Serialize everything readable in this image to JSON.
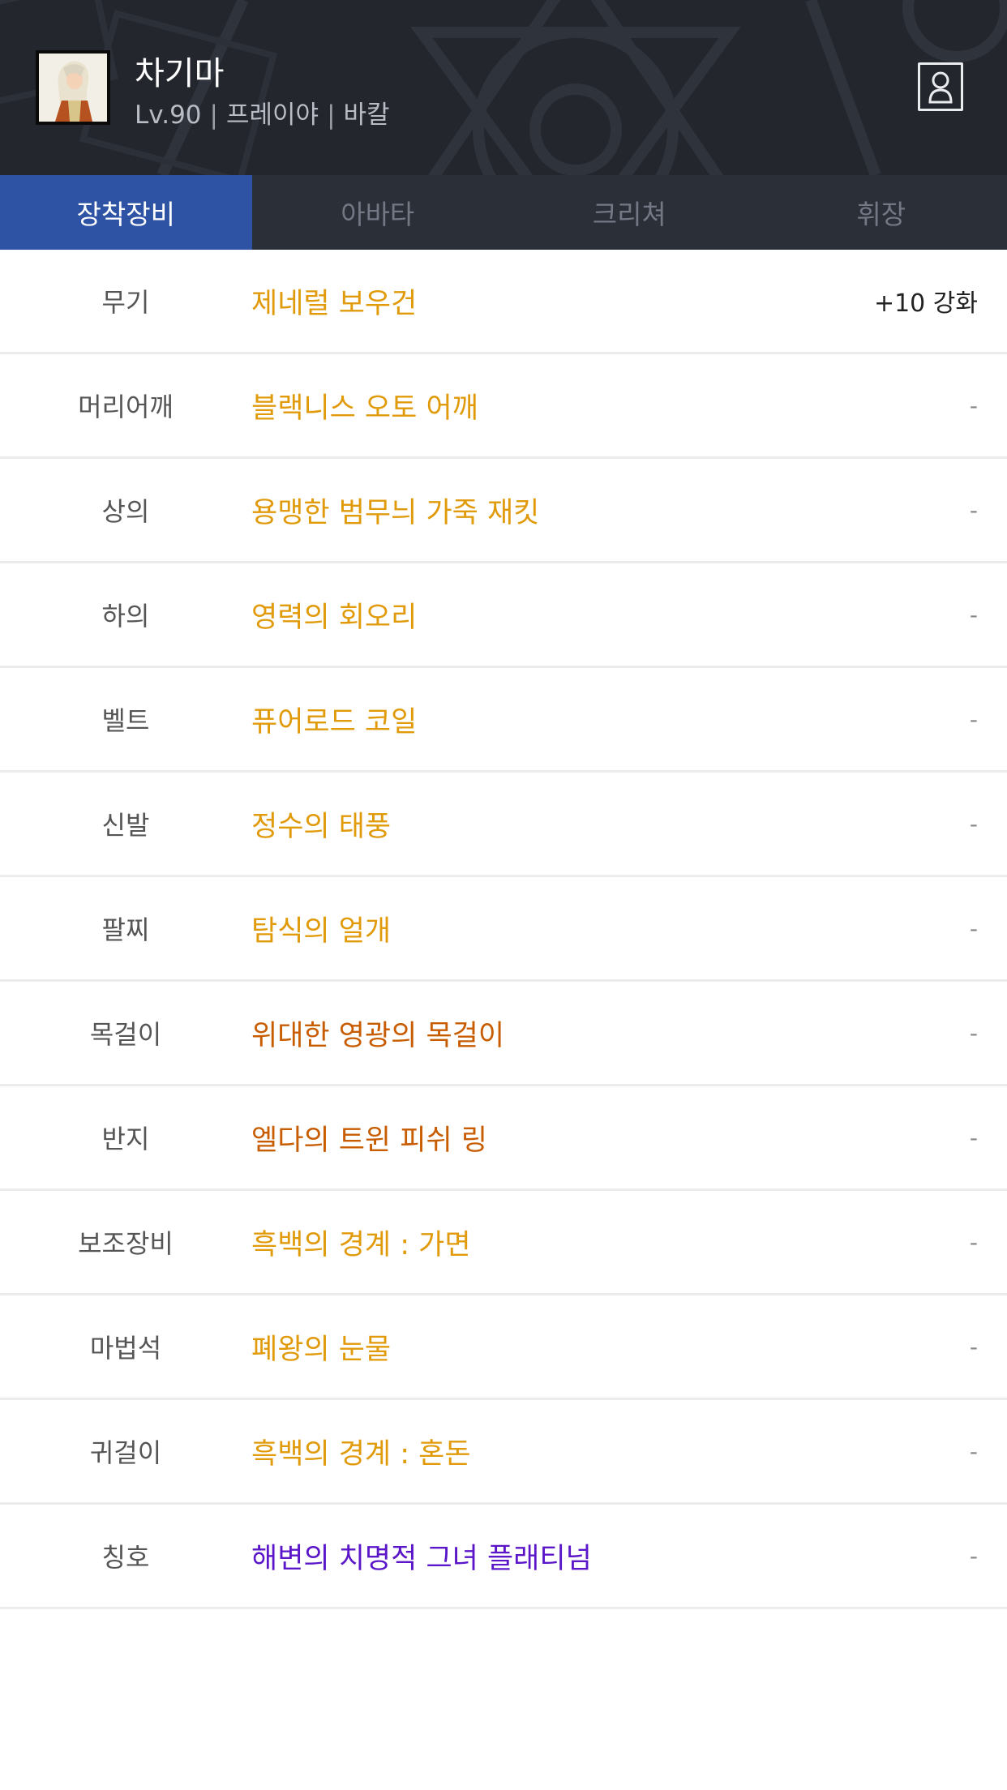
{
  "character": {
    "name": "차기마",
    "level": "Lv.90",
    "job": "프레이야",
    "server": "바칼",
    "separator": "|"
  },
  "tabs": [
    {
      "label": "장착장비",
      "active": true
    },
    {
      "label": "아바타",
      "active": false
    },
    {
      "label": "크리쳐",
      "active": false
    },
    {
      "label": "휘장",
      "active": false
    }
  ],
  "colors": {
    "unique": "#e09a0a",
    "legendary": "#c85c00",
    "epic_title": "#5a16c8",
    "active_tab": "#2e53a5"
  },
  "equipment": [
    {
      "slot": "무기",
      "item": "제네럴 보우건",
      "enhance": "+10 강화",
      "color": "#e09a0a"
    },
    {
      "slot": "머리어깨",
      "item": "블랙니스 오토 어깨",
      "enhance": "-",
      "color": "#e09a0a"
    },
    {
      "slot": "상의",
      "item": "용맹한 범무늬 가죽 재킷",
      "enhance": "-",
      "color": "#e09a0a"
    },
    {
      "slot": "하의",
      "item": "영력의 회오리",
      "enhance": "-",
      "color": "#e09a0a"
    },
    {
      "slot": "벨트",
      "item": "퓨어로드 코일",
      "enhance": "-",
      "color": "#e09a0a"
    },
    {
      "slot": "신발",
      "item": "정수의 태풍",
      "enhance": "-",
      "color": "#e09a0a"
    },
    {
      "slot": "팔찌",
      "item": "탐식의 얼개",
      "enhance": "-",
      "color": "#e09a0a"
    },
    {
      "slot": "목걸이",
      "item": "위대한 영광의 목걸이",
      "enhance": "-",
      "color": "#c85c00"
    },
    {
      "slot": "반지",
      "item": "엘다의 트윈 피쉬 링",
      "enhance": "-",
      "color": "#c85c00"
    },
    {
      "slot": "보조장비",
      "item": "흑백의 경계 : 가면",
      "enhance": "-",
      "color": "#e09a0a"
    },
    {
      "slot": "마법석",
      "item": "폐왕의 눈물",
      "enhance": "-",
      "color": "#e09a0a"
    },
    {
      "slot": "귀걸이",
      "item": "흑백의 경계 : 혼돈",
      "enhance": "-",
      "color": "#e09a0a"
    },
    {
      "slot": "칭호",
      "item": "해변의 치명적 그녀 플래티넘",
      "enhance": "-",
      "color": "#5a16c8"
    }
  ]
}
